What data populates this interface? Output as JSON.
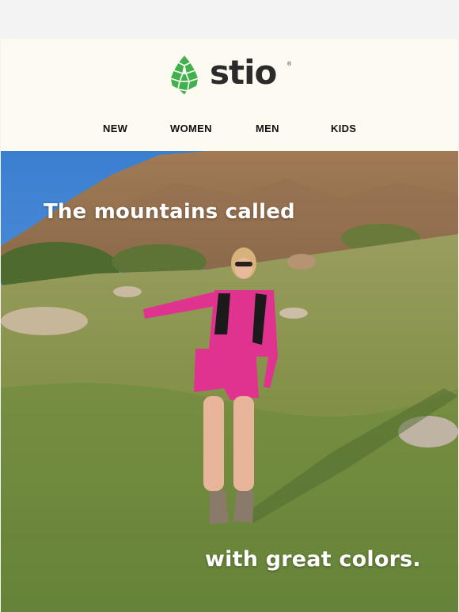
{
  "brand": {
    "name": "stio",
    "registered_mark": "®",
    "logo_icon": "pinecone-icon",
    "logo_color": "#3fb24f"
  },
  "nav": {
    "items": [
      "NEW",
      "WOMEN",
      "MEN",
      "KIDS"
    ]
  },
  "hero": {
    "headline_top": "The mountains called",
    "headline_bottom": "with great colors.",
    "image": "hiker-in-pink-outfit-on-grassy-mountain-slope",
    "accent_color": "#e0338f"
  },
  "colors": {
    "header_bg": "#fdfaf2",
    "page_bg": "#f3f3f3",
    "text_dark": "#111111"
  }
}
